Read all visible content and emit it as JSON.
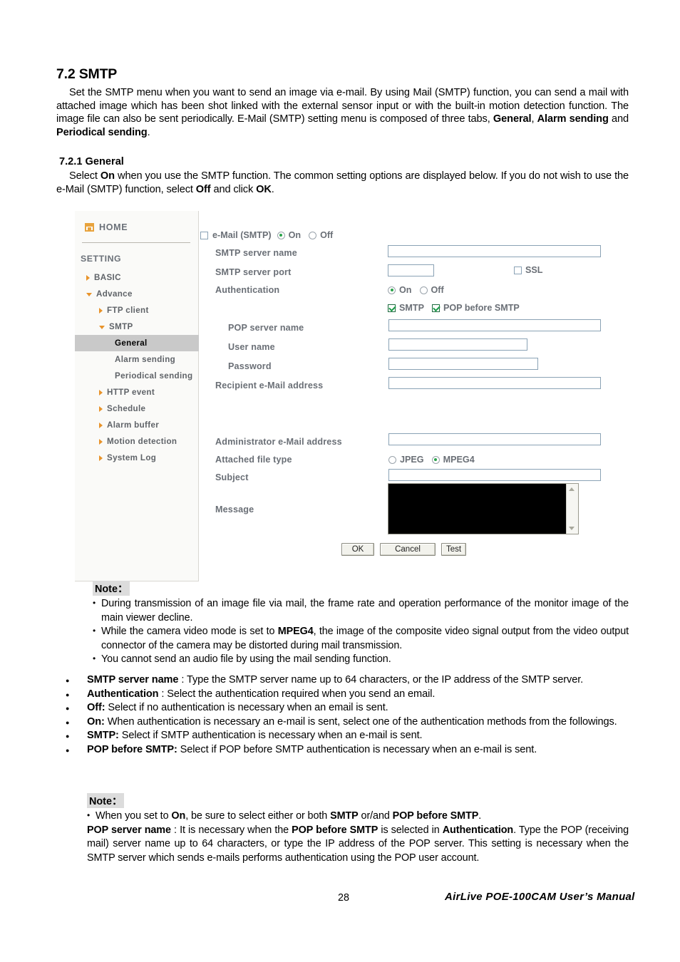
{
  "document": {
    "heading": "7.2 SMTP",
    "intro_html": "Set the SMTP menu when you want to send an image via e-mail. By using Mail (SMTP) function, you can send a mail with attached image which has been shot linked with the external sensor input or with the built-in motion detection function. The image file can also be sent periodically. E-Mail (SMTP) setting menu is composed of three tabs, <b>General</b>, <b>Alarm sending</b> and <b>Periodical sending</b>.",
    "subheading": "7.2.1 General",
    "general_html": "Select <b>On</b> when you use the SMTP function. The common setting options are displayed below. If you do not wish to use the e-Mail (SMTP) function, select <b>Off</b> and click <b>OK</b>."
  },
  "sidebar": {
    "home_label": "HOME",
    "section_label": "SETTING",
    "items": [
      {
        "label": "BASIC",
        "level": 0,
        "marker": "right",
        "selected": false
      },
      {
        "label": "Advance",
        "level": 0,
        "marker": "down",
        "selected": false
      },
      {
        "label": "FTP client",
        "level": 1,
        "marker": "right",
        "selected": false
      },
      {
        "label": "SMTP",
        "level": 1,
        "marker": "down",
        "selected": false
      },
      {
        "label": "General",
        "level": 2,
        "marker": "none",
        "selected": true
      },
      {
        "label": "Alarm sending",
        "level": 2,
        "marker": "none",
        "selected": false
      },
      {
        "label": "Periodical sending",
        "level": 2,
        "marker": "none",
        "selected": false
      },
      {
        "label": "HTTP event",
        "level": 1,
        "marker": "right",
        "selected": false
      },
      {
        "label": "Schedule",
        "level": 1,
        "marker": "right",
        "selected": false
      },
      {
        "label": "Alarm buffer",
        "level": 1,
        "marker": "right",
        "selected": false
      },
      {
        "label": "Motion detection",
        "level": 1,
        "marker": "right",
        "selected": false
      },
      {
        "label": "System Log",
        "level": 1,
        "marker": "right",
        "selected": false
      }
    ]
  },
  "form": {
    "title": "e-Mail (SMTP)",
    "title_on": "On",
    "title_off": "Off",
    "title_selected": "On",
    "title_checkbox_checked": false,
    "labels": {
      "smtp_server_name": "SMTP server name",
      "smtp_server_port": "SMTP server port",
      "ssl": "SSL",
      "authentication": "Authentication",
      "auth_on": "On",
      "auth_off": "Off",
      "auth_smtp": "SMTP",
      "auth_pop_before_smtp": "POP before SMTP",
      "pop_server_name": "POP server name",
      "user_name": "User name",
      "password": "Password",
      "recipient_email": "Recipient e-Mail address",
      "administrator_email": "Administrator e-Mail address",
      "attached_file_type": "Attached file type",
      "file_jpeg": "JPEG",
      "file_mpeg4": "MPEG4",
      "subject": "Subject",
      "message": "Message"
    },
    "values": {
      "smtp_server_name": "",
      "smtp_server_port": "",
      "pop_server_name": "",
      "user_name": "",
      "password": "",
      "recipient_email": "",
      "administrator_email": "",
      "subject": "",
      "message": ""
    },
    "states": {
      "ssl_checked": false,
      "auth_selected": "On",
      "smtp_checked": true,
      "pop_before_smtp_checked": true,
      "attached_file_type_selected": "MPEG4"
    },
    "buttons": {
      "ok": "OK",
      "cancel": "Cancel",
      "test": "Test"
    }
  },
  "note1": {
    "tag": "Note：",
    "items_html": [
      "During transmission of an image file via mail, the frame rate and operation performance of the monitor image of the main viewer decline.",
      "While the camera video mode is set to <b>MPEG4</b>, the image of the composite video signal output from the video output connector of the camera may be distorted during mail transmission.",
      "You cannot send an audio file by using the mail sending function."
    ]
  },
  "definitions": {
    "items_html": [
      "<b>SMTP server name</b> : Type the SMTP server name up to 64 characters, or the IP address of the SMTP server.",
      "<b>Authentication</b> : Select the authentication required when you send an email.",
      "<b>Off:</b> Select if no authentication is necessary when an email is sent.",
      "<b>On:</b> When authentication is necessary an e-mail is sent, select one of the authentication methods from the followings.",
      "<b>SMTP:</b> Select if SMTP authentication is necessary when an e-mail is sent.",
      "<b>POP before SMTP:</b> Select if POP before SMTP authentication is necessary when an e-mail is sent."
    ]
  },
  "note2": {
    "tag": "Note：",
    "items_html": [
      "When you set to <b>On</b>, be sure to select either or both <b>SMTP</b> or/and <b>POP before SMTP</b>.",
      "<b>POP server name</b> : It is necessary when the <b>POP before SMTP</b> is selected in <b>Authentication</b>. Type the POP (receiving mail) server name up to 64 characters, or type the IP address of the POP server. This setting is necessary when the SMTP server which sends e-mails performs authentication using the POP user account."
    ]
  },
  "footer": {
    "page_number": "28",
    "manual_title": "AirLive POE-100CAM User’s Manual"
  },
  "colors": {
    "accent_orange": "#e8932a",
    "label_gray": "#6a6f76",
    "field_border": "#8aa2b5",
    "selected_bg": "#c9c9c9",
    "check_green": "#1a9a46"
  }
}
